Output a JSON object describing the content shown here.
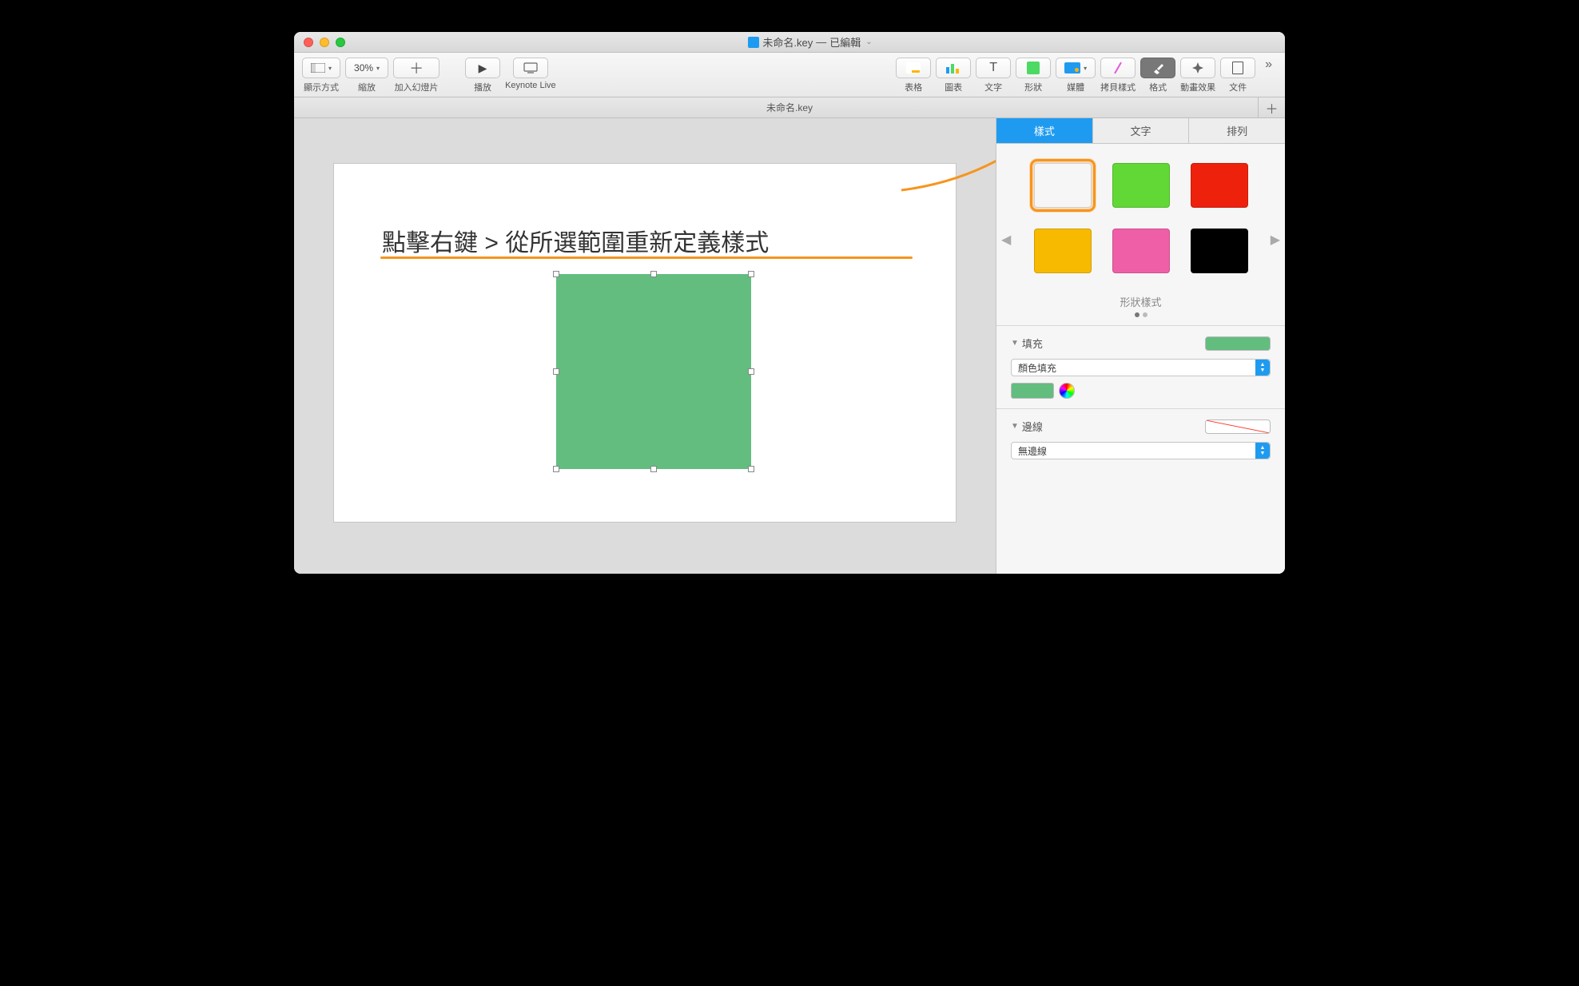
{
  "window": {
    "title": "未命名.key",
    "status": "已編輯"
  },
  "toolbar": {
    "view_label": "顯示方式",
    "zoom_value": "30%",
    "zoom_label": "縮放",
    "add_slide_label": "加入幻燈片",
    "play_label": "播放",
    "live_label": "Keynote Live",
    "table_label": "表格",
    "chart_label": "圖表",
    "text_label": "文字",
    "text_icon": "T",
    "shape_label": "形狀",
    "media_label": "媒體",
    "copy_style_label": "拷貝樣式",
    "format_label": "格式",
    "animate_label": "動畫效果",
    "document_label": "文件"
  },
  "tabbar": {
    "filename": "未命名.key"
  },
  "slide": {
    "instruction": "點擊右鍵 > 從所選範圍重新定義樣式"
  },
  "inspector": {
    "tabs": {
      "style": "樣式",
      "text": "文字",
      "arrange": "排列"
    },
    "styles": {
      "label": "形狀樣式",
      "swatches": [
        "#00a2ff",
        "#61d836",
        "#ee220c",
        "#f8ba00",
        "#ef5fa7",
        "#000000"
      ]
    },
    "fill": {
      "label": "填充",
      "type": "顏色填充",
      "color": "#62bd7f"
    },
    "border": {
      "label": "邊線",
      "type": "無邊線"
    }
  }
}
